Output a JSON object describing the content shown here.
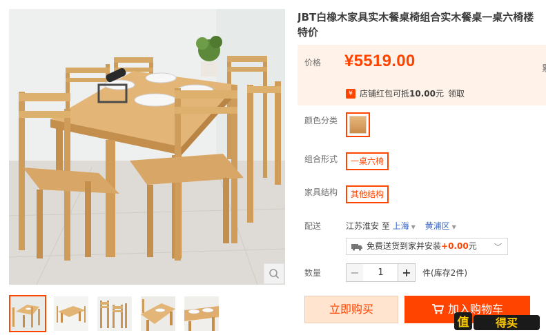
{
  "product": {
    "title_line1": "JBT白橡木家具实木餐桌椅组合实木餐桌一桌六椅楼",
    "title_line2": "特价"
  },
  "price": {
    "label": "价格",
    "value": "¥5519.00",
    "right_cut": "累"
  },
  "coupon": {
    "icon": "¥",
    "prefix": "店铺红包可抵",
    "amount": "10.00",
    "suffix": "元",
    "claim": "领取"
  },
  "options": {
    "color_label": "颜色分类",
    "combo_label": "组合形式",
    "combo_value": "一桌六椅",
    "structure_label": "家具结构",
    "structure_value": "其他结构"
  },
  "shipping": {
    "label": "配送",
    "from": "江苏淮安 至",
    "city": "上海",
    "district": "黄浦区",
    "method_prefix": "免费送货到家并安装",
    "method_fee": "+0.00",
    "method_suffix": "元"
  },
  "quantity": {
    "label": "数量",
    "minus": "−",
    "value": "1",
    "plus": "+",
    "stock": "件(库存2件)"
  },
  "actions": {
    "buy_now": "立即购买",
    "add_to_cart": "加入购物车"
  },
  "icons": {
    "zoom": "magnifier-icon",
    "truck": "truck-icon",
    "cart": "cart-icon"
  },
  "colors": {
    "accent": "#ff4400",
    "price_bg": "#fff2e8",
    "link": "#3366cc"
  },
  "watermark": {
    "text": "值得买"
  }
}
